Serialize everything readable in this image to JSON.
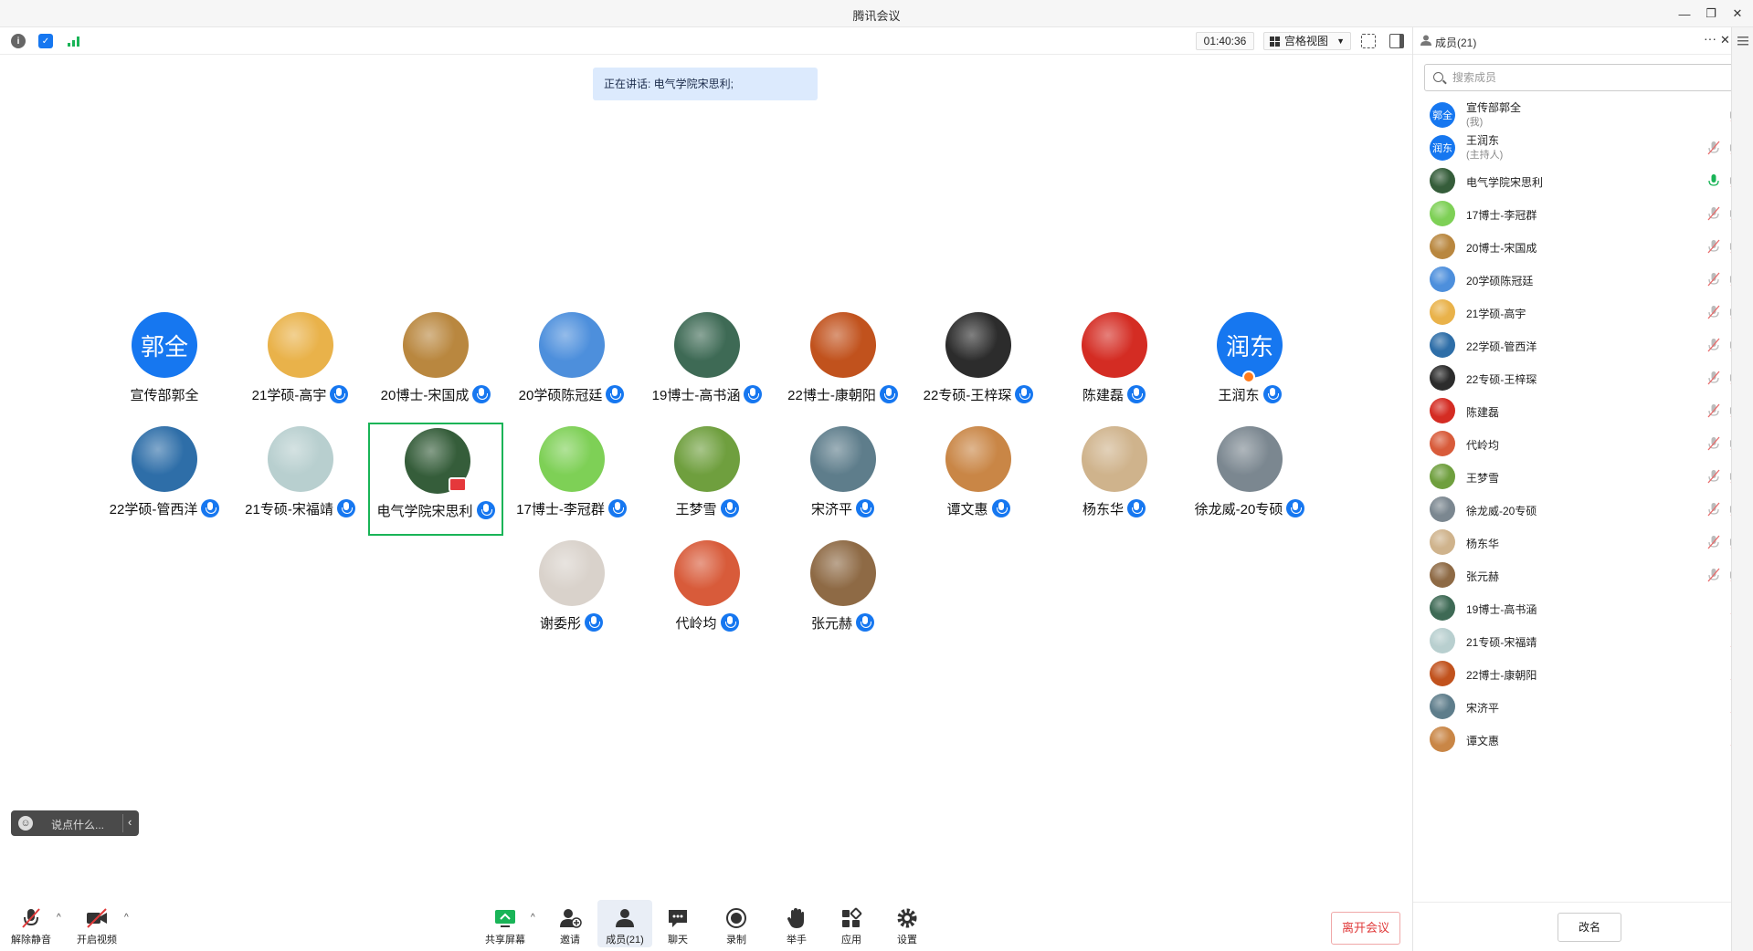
{
  "window": {
    "title": "腾讯会议"
  },
  "toolbar": {
    "timer": "01:40:36",
    "view_label": "宫格视图"
  },
  "speaking": "正在讲话: 电气学院宋思利;",
  "grid": [
    {
      "name": "宣传部郭全",
      "initials": "郭全",
      "color": "#1677f0",
      "mic": false
    },
    {
      "name": "21学硕-高宇",
      "color": "#e9b24a",
      "mic": true
    },
    {
      "name": "20博士-宋国成",
      "color": "#b9873f",
      "mic": true
    },
    {
      "name": "20学硕陈冠廷",
      "color": "#4d8fdc",
      "mic": true
    },
    {
      "name": "19博士-高书涵",
      "color": "#3e6a55",
      "mic": true
    },
    {
      "name": "22博士-康朝阳",
      "color": "#c1521d",
      "mic": true
    },
    {
      "name": "22专硕-王梓琛",
      "color": "#2c2c2c",
      "mic": true
    },
    {
      "name": "陈建磊",
      "color": "#d42c23",
      "mic": true
    },
    {
      "name": "王润东",
      "initials": "润东",
      "color": "#1677f0",
      "mic": true,
      "host": true
    },
    {
      "name": "22学硕-管西洋",
      "color": "#2e6ea8",
      "mic": true
    },
    {
      "name": "21专硕-宋福靖",
      "color": "#b8cfcf",
      "mic": true
    },
    {
      "name": "电气学院宋思利",
      "color": "#355d3a",
      "mic": true,
      "active": true,
      "sharing": true
    },
    {
      "name": "17博士-李冠群",
      "color": "#7ed056",
      "mic": true
    },
    {
      "name": "王梦雪",
      "color": "#6f9f3e",
      "mic": true
    },
    {
      "name": "宋济平",
      "color": "#5e7d8b",
      "mic": true
    },
    {
      "name": "谭文惠",
      "color": "#c98646",
      "mic": true
    },
    {
      "name": "杨东华",
      "color": "#cfb38c",
      "mic": true
    },
    {
      "name": "徐龙威-20专硕",
      "color": "#7b8790",
      "mic": true
    },
    {
      "name": "谢委彤",
      "color": "#d9d2cb",
      "mic": true
    },
    {
      "name": "代岭均",
      "color": "#d85b3a",
      "mic": true
    },
    {
      "name": "张元赫",
      "color": "#8e6a45",
      "mic": true
    }
  ],
  "chat": {
    "placeholder": "说点什么..."
  },
  "bottom": {
    "unmute": "解除静音",
    "video": "开启视频",
    "share": "共享屏幕",
    "invite": "邀请",
    "members": "成员(21)",
    "chat": "聊天",
    "record": "录制",
    "raise_hand": "举手",
    "apps": "应用",
    "settings": "设置",
    "leave": "离开会议"
  },
  "panel": {
    "title": "成员(21)",
    "search_placeholder": "搜索成员",
    "rename": "改名",
    "members": [
      {
        "name": "宣传部郭全",
        "sub": "(我)",
        "initials": "郭全",
        "color": "#1677f0",
        "mic": "none",
        "video": true
      },
      {
        "name": "王润东",
        "sub": "(主持人)",
        "initials": "润东",
        "color": "#1677f0",
        "mic": "muted",
        "video": true
      },
      {
        "name": "电气学院宋思利",
        "color": "#355d3a",
        "mic": "speaking",
        "video": true
      },
      {
        "name": "17博士-李冠群",
        "color": "#7ed056",
        "mic": "muted",
        "video": true
      },
      {
        "name": "20博士-宋国成",
        "color": "#b9873f",
        "mic": "muted",
        "video": true
      },
      {
        "name": "20学硕陈冠廷",
        "color": "#4d8fdc",
        "mic": "muted",
        "video": true
      },
      {
        "name": "21学硕-高宇",
        "color": "#e9b24a",
        "mic": "muted",
        "video": true
      },
      {
        "name": "22学硕-管西洋",
        "color": "#2e6ea8",
        "mic": "muted",
        "video": true
      },
      {
        "name": "22专硕-王梓琛",
        "color": "#2c2c2c",
        "mic": "muted",
        "video": true
      },
      {
        "name": "陈建磊",
        "color": "#d42c23",
        "mic": "muted",
        "video": true
      },
      {
        "name": "代岭均",
        "color": "#d85b3a",
        "mic": "muted",
        "video": true
      },
      {
        "name": "王梦雪",
        "color": "#6f9f3e",
        "mic": "muted",
        "video": true
      },
      {
        "name": "徐龙威-20专硕",
        "color": "#7b8790",
        "mic": "muted",
        "video": true
      },
      {
        "name": "杨东华",
        "color": "#cfb38c",
        "mic": "muted",
        "video": true
      },
      {
        "name": "张元赫",
        "color": "#8e6a45",
        "mic": "muted",
        "video": true
      },
      {
        "name": "19博士-高书涵",
        "color": "#3e6a55",
        "mic": "muted",
        "video": false
      },
      {
        "name": "21专硕-宋福靖",
        "color": "#b8cfcf",
        "mic": "muted",
        "video": false
      },
      {
        "name": "22博士-康朝阳",
        "color": "#c1521d",
        "mic": "muted",
        "video": false
      },
      {
        "name": "宋济平",
        "color": "#5e7d8b",
        "mic": "muted",
        "video": false
      },
      {
        "name": "谭文惠",
        "color": "#c98646",
        "mic": "muted",
        "video": false
      }
    ]
  },
  "colors": {
    "accent": "#1677f0",
    "active_border": "#19b457",
    "leave": "#e03a3a"
  }
}
